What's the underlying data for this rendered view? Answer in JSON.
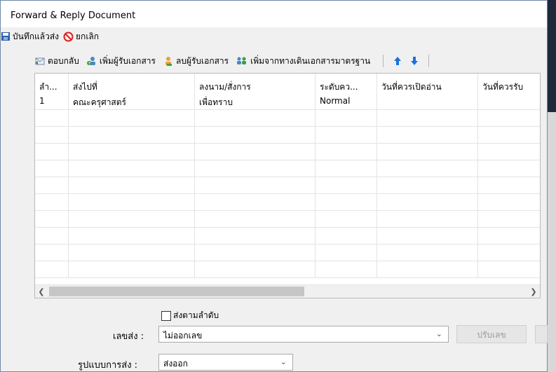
{
  "window": {
    "title": "Forward & Reply Document"
  },
  "actions": {
    "save_send": "บันทึกแล้วส่ง",
    "cancel": "ยกเลิก"
  },
  "toolbar": {
    "reply": "ตอบกลับ",
    "add_recipient": "เพิ่มผู้รับเอกสาร",
    "remove_recipient": "ลบผู้รับเอกสาร",
    "add_from_standard": "เพิ่มจากทางเดินเอกสารมาตรฐาน"
  },
  "grid": {
    "columns": [
      "ลำ...",
      "ส่งไปที่",
      "ลงนาม/สั่งการ",
      "ระดับคว...",
      "วันที่ควรเปิดอ่าน",
      "วันที่ควรรับ"
    ],
    "rows": [
      [
        "1",
        "คณะครุศาสตร์",
        "เพื่อทราบ",
        "Normal",
        "",
        ""
      ]
    ]
  },
  "form": {
    "send_in_order": "ส่งตามลำดับ",
    "number_label": "เลขส่ง :",
    "number_value": "ไม่ออกเลข",
    "adjust_button": "ปรับเลข",
    "type_label": "รูปแบบการส่ง :",
    "type_value": "ส่งออก"
  },
  "colors": {
    "accent_blue": "#1e6fd9",
    "cancel_red": "#e02020"
  }
}
